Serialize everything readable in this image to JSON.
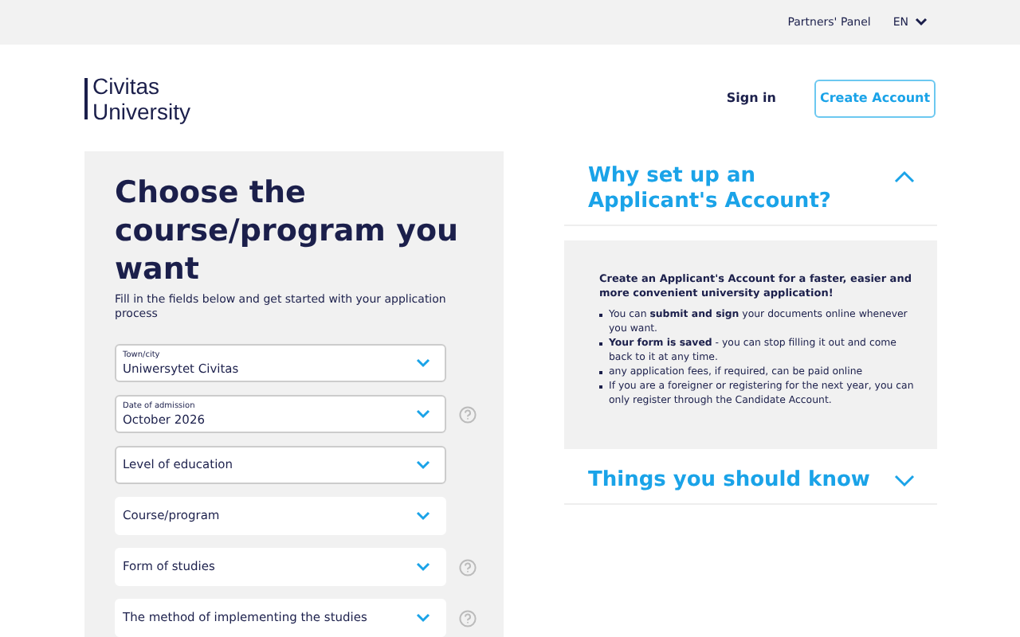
{
  "top_bar": {
    "partners_link": "Partners' Panel",
    "language": "EN"
  },
  "header": {
    "logo_lines": [
      "Civitas",
      "University"
    ],
    "sign_in": "Sign in",
    "create_account": "Create Account"
  },
  "form": {
    "title": "Choose the course/program you want",
    "subtitle": "Fill in the fields below and get started with your application process",
    "fields": [
      {
        "label": "Town/city",
        "value": "Uniwersytet Civitas",
        "disabled": false,
        "help": false
      },
      {
        "label": "Date of admission",
        "value": "October 2026",
        "disabled": false,
        "help": true
      },
      {
        "placeholder": "Level of education",
        "disabled": false,
        "help": false
      },
      {
        "placeholder": "Course/program",
        "disabled": true,
        "help": false
      },
      {
        "placeholder": "Form of studies",
        "disabled": true,
        "help": true
      },
      {
        "placeholder": "The method of implementing the studies",
        "disabled": true,
        "help": true
      }
    ]
  },
  "accordion": [
    {
      "title": "Why set up an Applicant's Account?",
      "expanded": true,
      "intro": "Create an Applicant's Account for a faster, easier and more convenient university application!",
      "bullets": [
        "You can **submit and sign** your documents online whenever you want.",
        "**Your form is saved** - you can stop filling it out and come back to it at any time.",
        "any application fees, if required, can be paid online",
        "If you are a foreigner or registering for the next year, you can only register through the Candidate Account."
      ]
    },
    {
      "title": "Things you should know",
      "expanded": false
    }
  ]
}
